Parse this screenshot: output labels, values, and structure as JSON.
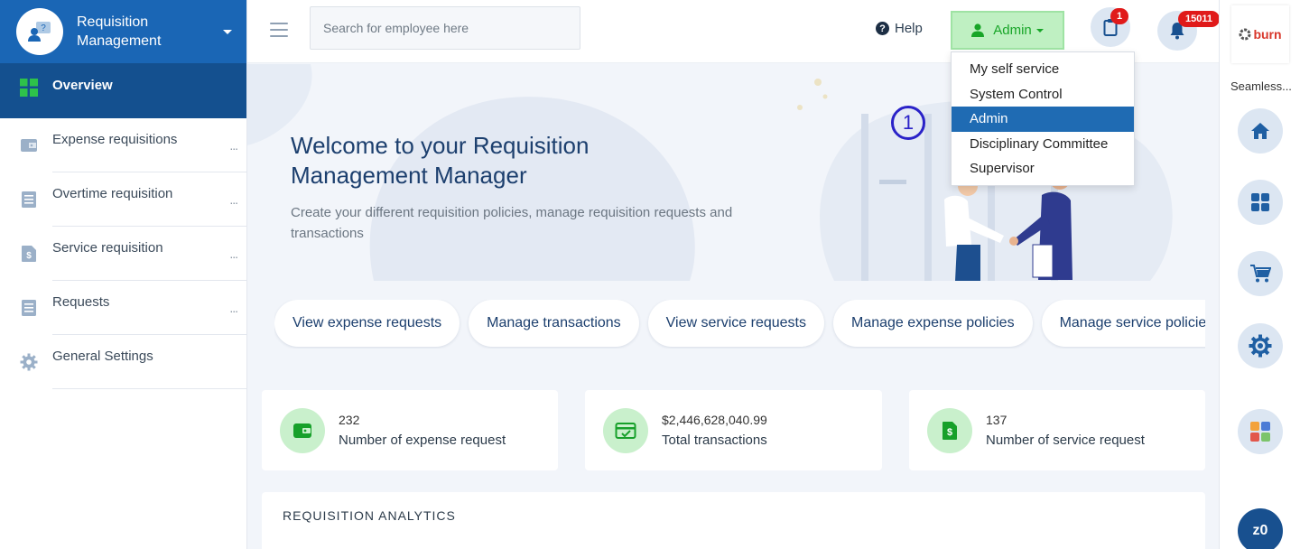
{
  "sidebar": {
    "brand": {
      "title_line1": "Requisition",
      "title_line2": "Management"
    },
    "items": [
      {
        "label": "Overview",
        "icon": "grid-icon",
        "active": true
      },
      {
        "label": "Expense requisitions",
        "icon": "wallet-icon",
        "more": "..."
      },
      {
        "label": "Overtime requisition",
        "icon": "document-icon",
        "more": "..."
      },
      {
        "label": "Service requisition",
        "icon": "dollar-file-icon",
        "more": "..."
      },
      {
        "label": "Requests",
        "icon": "document-icon",
        "more": "..."
      },
      {
        "label": "General Settings",
        "icon": "gear-icon"
      }
    ]
  },
  "topbar": {
    "search_placeholder": "Search for employee here",
    "help_label": "Help",
    "role_button_label": "Admin",
    "clipboard_badge": "1",
    "notification_badge": "15011"
  },
  "role_menu": {
    "items": [
      "My self service",
      "System Control",
      "Admin",
      "Disciplinary Committee",
      "Supervisor"
    ],
    "selected": "Admin"
  },
  "marker": {
    "label": "1"
  },
  "hero": {
    "title": "Welcome to your Requisition Management Manager",
    "subtitle": "Create your different requisition policies, manage requisition requests and transactions"
  },
  "quick_actions": [
    "View expense requests",
    "Manage transactions",
    "View service requests",
    "Manage expense policies",
    "Manage service policies"
  ],
  "stats": [
    {
      "value": "232",
      "label": "Number of expense request",
      "icon": "wallet-icon"
    },
    {
      "value": "$2,446,628,040.99",
      "label": "Total transactions",
      "icon": "card-check-icon"
    },
    {
      "value": "137",
      "label": "Number of service request",
      "icon": "dollar-file-icon"
    }
  ],
  "analytics": {
    "title": "REQUISITION ANALYTICS"
  },
  "rail": {
    "company_logo_text": "burn",
    "company_name": "Seamless...",
    "user_initials": "z0"
  },
  "colors": {
    "brand_blue": "#1a66b5",
    "active_blue": "#14508f",
    "green": "#18a528",
    "badge_red": "#e01a1a"
  }
}
